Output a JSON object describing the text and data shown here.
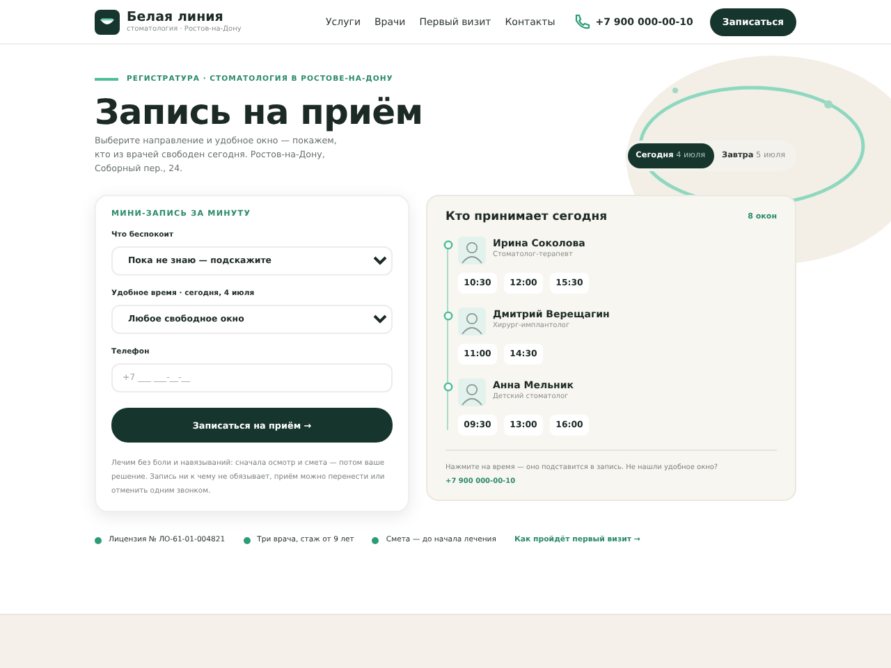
{
  "header": {
    "brand": "Белая линия",
    "tagline": "стоматология · Ростов-на-Дону",
    "nav": [
      "Услуги",
      "Врачи",
      "Первый визит",
      "Контакты"
    ],
    "phone": "+7 900 000-00-10",
    "cta": "Записаться"
  },
  "hero": {
    "eyebrow": "РЕГИСТРАТУРА · СТОМАТОЛОГИЯ В РОСТОВЕ-НА-ДОНУ",
    "title": "Запись на приём",
    "description": "Выберите направление и удобное окно — покажем, кто из врачей свободен сегодня. Ростов-на-Дону, Соборный пер., 24."
  },
  "day_tabs": [
    {
      "label": "Сегодня",
      "date": "4 июля",
      "selected": true
    },
    {
      "label": "Завтра",
      "date": "5 июля",
      "selected": false
    }
  ],
  "form": {
    "title": "МИНИ-ЗАПИСЬ ЗА МИНУТУ",
    "fields": [
      {
        "kind": "select",
        "label": "Что беспокоит",
        "value": "Пока не знаю — подскажите"
      },
      {
        "kind": "select",
        "label": "Удобное время · сегодня, 4 июля",
        "value": "Любое свободное окно"
      },
      {
        "kind": "input",
        "label": "Телефон",
        "placeholder": "+7 ___ ___-__-__"
      }
    ],
    "submit": "Записаться на приём",
    "submit_icon": "→",
    "note": "Лечим без боли и навязываний: сначала осмотр и смета — потом ваше решение. Запись ни к чему не обязывает, приём можно перенести или отменить одним звонком."
  },
  "doctors": {
    "title": "Кто принимает сегодня",
    "count": "8 окон",
    "items": [
      {
        "name": "Ирина Соколова",
        "role": "Стоматолог-терапевт",
        "slots": [
          "10:30",
          "12:00",
          "15:30"
        ]
      },
      {
        "name": "Дмитрий Верещагин",
        "role": "Хирург-имплантолог",
        "slots": [
          "11:00",
          "14:30"
        ]
      },
      {
        "name": "Анна Мельник",
        "role": "Детский стоматолог",
        "slots": [
          "09:30",
          "13:00",
          "16:00"
        ]
      }
    ],
    "note": "Нажмите на время — оно подставится в запись. Не нашли удобное окно?",
    "note_phone": "+7 900 000-00-10"
  },
  "facts": [
    {
      "kind": "fact",
      "text": "Лицензия № ЛО-61-01-004821"
    },
    {
      "kind": "fact",
      "text": "Три врача, стаж от 9 лет"
    },
    {
      "kind": "fact",
      "text": "Смета — до начала лечения"
    },
    {
      "kind": "link",
      "text": "Как пройдёт первый визит",
      "icon": "→"
    }
  ]
}
